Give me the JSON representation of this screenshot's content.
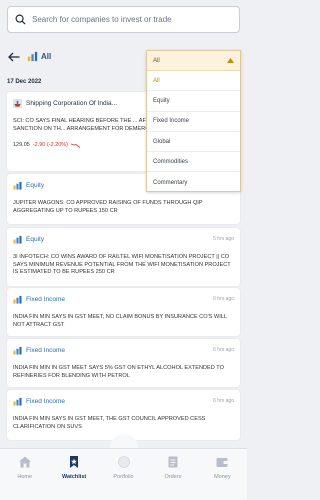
{
  "search": {
    "placeholder": "Search for companies to invest or trade"
  },
  "filter": {
    "label": "All"
  },
  "date": "17 Dec 2022",
  "dropdown": {
    "selected": "All",
    "options": [
      "All",
      "Equity",
      "Fixed Income",
      "Global",
      "Commodities",
      "Commentary"
    ]
  },
  "cards": [
    {
      "company": "Shipping Corporation Of India...",
      "body": "SCI: CO SAYS FINAL HEARING BEFORE THE ... AFFAIRS FOR OBTAINING SANCTION ON TH... ARRANGEMENT FOR DEMERGER IS FIXED C...",
      "price": "129.05",
      "change": "-2.90 (-2.20%)"
    },
    {
      "category": "Equity",
      "body": "JUPITER WAGONS: CO APPROVED RAISING OF FUNDS THROUGH QIP AGGREGATING UP TO RUPEES 150 CR"
    },
    {
      "category": "Equity",
      "time": "5 hrs ago",
      "body": "3I INFOTECH: CO WINS AWARD OF RAILTEL WIFI MONETISATION PROJECT || CO SAYS MINIMUM REVENUE POTENTIAL FROM THE WIFI MONETISATION PROJECT IS ESTIMATED TO BE RUPEES 250 CR"
    },
    {
      "category": "Fixed Income",
      "time": "6 hrs ago",
      "body": "INDIA FIN MIN SAYS IN GST MEET, NO CLAIM BONUS BY INSURANCE CO'S WILL NOT ATTRACT GST"
    },
    {
      "category": "Fixed Income",
      "time": "6 hrs ago",
      "body": "INDIA FIN MIN IN GST MEET SAYS 5% GST ON ETHYL ALCOHOL EXTENDED TO REFINERIES FOR BLENDING WITH PETROL"
    },
    {
      "category": "Fixed Income",
      "time": "6 hrs ago",
      "body": "INDIA FIN MIN SAYS IN GST MEET, THE GST COUNCIL APPROVED CESS CLARIFICATION ON SUVS"
    }
  ],
  "nav": {
    "items": [
      {
        "label": "Home",
        "icon": "home-icon"
      },
      {
        "label": "Watchlist",
        "icon": "bookmark-icon"
      },
      {
        "label": "Portfolio",
        "icon": "portfolio-icon"
      },
      {
        "label": "Orders",
        "icon": "orders-icon"
      },
      {
        "label": "Money",
        "icon": "wallet-icon"
      }
    ],
    "active": "Watchlist"
  },
  "colors": {
    "accent_blue": "#2d6bb3",
    "navy": "#1d3765",
    "loss_red": "#d93025",
    "dropdown_active": "#c68c00"
  }
}
